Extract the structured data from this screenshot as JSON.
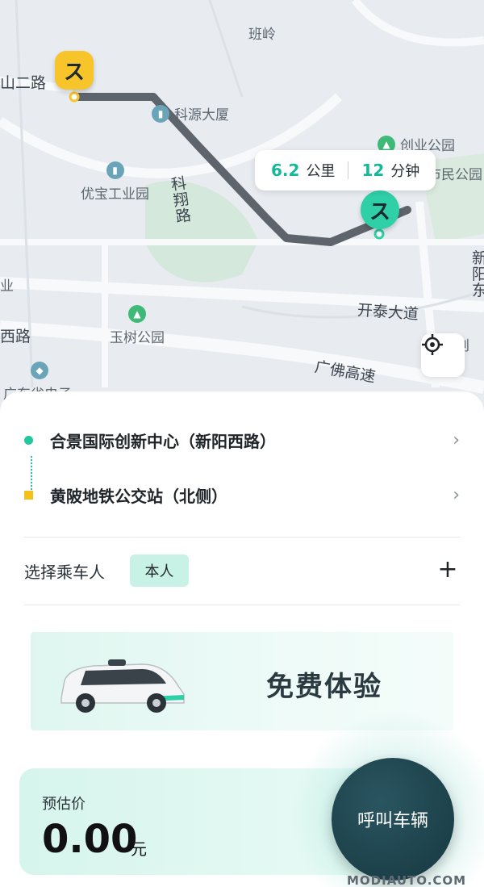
{
  "map": {
    "labels": {
      "banling": "班岭",
      "rd2": "山二路",
      "keyuan": "科源大厦",
      "chuangye": "创业公园",
      "shimin": "市民公园",
      "youbao": "优宝工业园",
      "kexiang": "科翔路",
      "xinyangdong": "新阳东",
      "kaitai": "开泰大道",
      "yushu": "玉树公园",
      "xilu": "西路",
      "guangfo": "广佛高速",
      "guangdong": "广东省电子",
      "ye": "业",
      "longchuang": "龙创"
    },
    "route_info": {
      "distance_value": "6.2",
      "distance_unit": "公里",
      "time_value": "12",
      "time_unit": "分钟"
    },
    "pin_glyph": "ス"
  },
  "trip": {
    "origin": "合景国际创新中心（新阳西路）",
    "destination": "黄陂地铁公交站（北侧）",
    "chevron": "›"
  },
  "passenger": {
    "label": "选择乘车人",
    "selected": "本人",
    "add_symbol": "+"
  },
  "banner": {
    "text": "免费体验"
  },
  "price": {
    "label": "预估价",
    "value": "0.00",
    "unit": "元"
  },
  "call_button": {
    "label": "呼叫车辆"
  },
  "watermark": "MODIAUTO.COM",
  "colors": {
    "accent": "#22c7a0",
    "start_pin": "#f7c52a",
    "route": "#5d646c",
    "call_button": "#163840"
  }
}
